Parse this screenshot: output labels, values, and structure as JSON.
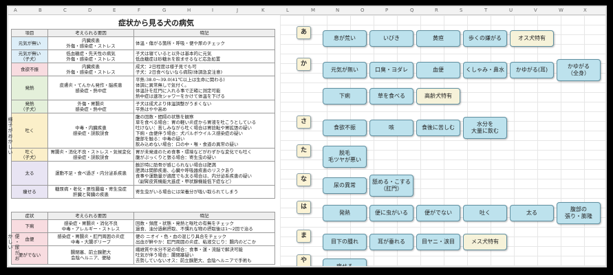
{
  "title": "症状から見る犬の病気",
  "col_letters": [
    "A",
    "B",
    "C",
    "D",
    "E",
    "F",
    "G",
    "H",
    "I",
    "J",
    "K",
    "L",
    "M",
    "N",
    "O",
    "P",
    "Q",
    "R",
    "S",
    "T",
    "U",
    "V",
    "W",
    "X"
  ],
  "table1": {
    "headers": [
      "項目",
      "考えられる要因",
      "特記"
    ],
    "side_label": "様子がおかしい",
    "rows": [
      {
        "item": "元気が無い",
        "cause": "内臓疾患\n外傷・感染症・ストレス",
        "note": "体温・傷がる箇所・呼吸・便や尿のチェック",
        "bg": "bg-blue"
      },
      {
        "item": "元気が無い\n（子犬）",
        "cause": "低血糖症・先天性の病気\n外傷・感染症・ストレス",
        "note": "子犬は寝ていると以外は基本的に元気\n低血糖症は砂糖水を飲ませるなど応急処置",
        "bg": "bg-blue"
      },
      {
        "item": "食欲不振",
        "cause": "内臓疾患\n外傷・感染症・ストレス",
        "note": "成犬：2日程度は様子見でも可\n子犬：2日食べないなら病院(体調急変注意)",
        "bg": "bg-pink"
      },
      {
        "item": "発熱",
        "cause": "皮膚炎・てんかん発作・脳疾患\n感染症・熱中症",
        "note": "平熱:38.0～39.0(41℃以上は生命に関わる)\n体調に異常無しで気付く。\n体温計を肛門に入れる事で正確に測定可能\n熱中症は速攻シャワーをかけて体温を下げる",
        "bg": "bg-green"
      },
      {
        "item": "発熱\n（子犬）",
        "cause": "外傷・胃腸炎\n感染症・熱中症",
        "note": "子犬は成犬より体温調整がうまくない\n平熱はやや高め",
        "bg": "bg-green"
      },
      {
        "item": "吐く",
        "cause": "中毒・内臓疾患\n感染症・誤飲誤食",
        "note": "腹の回数・間隔の状態を観察\n草を食べる場合：胃の軽い炎症から胃液を吐こうとしている\n吐けない：苦しみながら吐く場合は胃捻転や胃拡張の疑い\n下痢・血便伴う場合：犬パルボウイルス感染症の疑い\n腹部を触る：中毒の疑い\n飲み込めない場合：口の中・喉・食道の異常の疑い",
        "bg": "bg-yellow"
      },
      {
        "item": "吐く\n（子犬）",
        "cause": "胃腸炎・消化不良・ストレス・気候変化\n感染症・誤飲誤食",
        "note": "胃が未発達のため食事・環境などがわずかな変化でも吐く\n腹がぷっくりと張る場合：寄生虫の疑い",
        "bg": "bg-yellow"
      },
      {
        "item": "太る",
        "cause": "運動不足・食べ過ぎ・内分泌系疾患",
        "note": "触診時に肋骨が感じられない場合は肥満\n肥満は関節疾患、心臓や呼吸器疾患のリスクあり\n食事や運動量が適度でも太る場合は、内分泌系疾患の疑い\n（副腎皮質機能亢進症・甲状腺機能低下症など）",
        "bg": "bg-lav"
      },
      {
        "item": "痩せる",
        "cause": "糖尿病・老化・悪性腫瘍・寄生虫症\n肝臓と腎臓の疾患",
        "note": "寄生虫がいる場合には栄養分が吸い取られてしまう",
        "bg": "bg-lav"
      }
    ]
  },
  "table2": {
    "headers": [
      "症状",
      "考えられる要因",
      "特記"
    ],
    "side_label": "便・尿がおかしい",
    "rows": [
      {
        "item": "下痢",
        "cause": "感染症・胃腸炎・消化不良\n中毒・アレルギー・ストレス",
        "note": "回数・頻度・状態・発熱と嘔吐の有無をチェック\n過食、油分過剰摂取、不慣れな物の摂取後は1～2回で治る",
        "bg": "bg-pink"
      },
      {
        "item": "血便",
        "cause": "感染症・胃腸炎・肛門周囲の炎症\n中毒・大腸ポリープ",
        "note": "便の ニオイ・色・血の混じり具合をチェック\n出血が鮮やか：肛門周囲の炎症、粘液交じり：腸内のどこか",
        "bg": "bg-pink"
      },
      {
        "item": "便がでない",
        "cause": "腸閉塞、前立腺肥大\n会陰ヘルニア、便秘",
        "note": "繊維質や水分不足の場合：食事・運・流脳で解決可能\n吐気が伴う場合：腸閉塞疑い\n去勢していないオス：前立腺肥大、会陰ヘルニアで手術も",
        "bg": "bg-pink"
      }
    ]
  },
  "index": {
    "groups": [
      {
        "kana": "あ",
        "tags": [
          {
            "label": "息が荒い"
          },
          {
            "label": "いびき"
          },
          {
            "label": "黄疸"
          },
          {
            "label": "歩くの嫌がる"
          },
          {
            "label": "オス犬特有",
            "yellow": true
          }
        ]
      },
      {
        "kana": "か",
        "tags": [
          {
            "label": "元気が無い"
          },
          {
            "label": "口臭・ヨダレ"
          },
          {
            "label": "血便"
          },
          {
            "label": "くしゃみ・鼻水"
          },
          {
            "label": "かゆがる(耳)"
          },
          {
            "label": "かゆがる\n（全身）",
            "tall": true
          }
        ]
      },
      {
        "kana": "",
        "tags": [
          {
            "label": "下痢"
          },
          {
            "label": "草を食べる"
          },
          {
            "label": "高齢犬特有",
            "yellow": true
          }
        ]
      },
      {
        "kana": "さ",
        "tags": [
          {
            "label": "食欲不振"
          },
          {
            "label": "咳"
          },
          {
            "label": "食後に苦しむ"
          },
          {
            "label": "水分を\n大量に飲む",
            "tall": true
          }
        ]
      },
      {
        "kana": "た",
        "tags": [
          {
            "label": "脱毛\n毛ツヤが悪い",
            "tall": true
          }
        ]
      },
      {
        "kana": "な",
        "tags": [
          {
            "label": "尿の異常"
          },
          {
            "label": "舐める・こする\n（肛門）",
            "tall": true
          }
        ]
      },
      {
        "kana": "は",
        "tags": [
          {
            "label": "発熱"
          },
          {
            "label": "便に虫がいる"
          },
          {
            "label": "便がでない"
          },
          {
            "label": "吐く"
          },
          {
            "label": "太る"
          },
          {
            "label": "腹部の\n張り・膨隆",
            "tall": true
          }
        ]
      },
      {
        "kana": "ま",
        "tags": [
          {
            "label": "目下の腫れ"
          },
          {
            "label": "耳が垂れる"
          },
          {
            "label": "目ヤニ・涙目"
          },
          {
            "label": "メス犬特有",
            "yellow": true
          }
        ]
      },
      {
        "kana": "や",
        "tags": [
          {
            "label": "痩せる"
          }
        ]
      }
    ]
  }
}
